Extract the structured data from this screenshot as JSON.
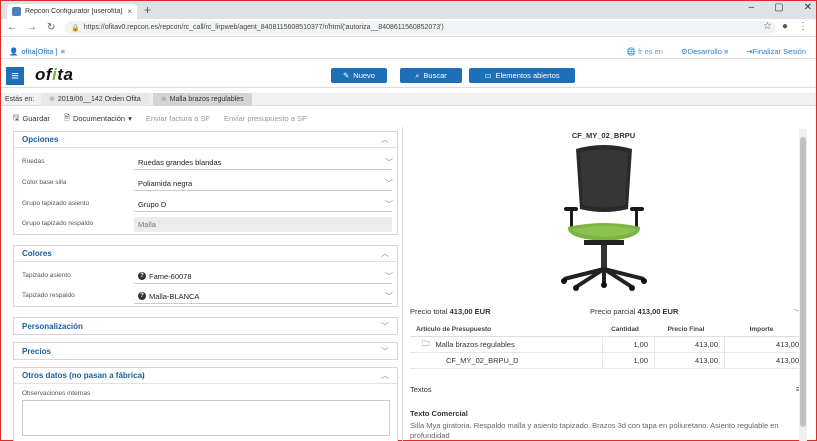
{
  "browser": {
    "tab_title": "Repcon Configurator [userofita]",
    "tab_close": "×",
    "new_tab": "+",
    "url": "https://ofitav0.repcon.es/repcon/rc_call/rc_lirpweb/agent_8408115608510377/r/html('autoriza__8408611560852073')",
    "win_min": "–",
    "win_max": "▢",
    "win_close": "✕"
  },
  "top": {
    "user": "ofita[Ofita ]",
    "languages": "fr  es  en",
    "env": "Desarrollo",
    "logout": "Finalizar Sesión"
  },
  "appbar": {
    "logo_a": "of",
    "logo_b": "i",
    "logo_c": "ta",
    "nuevo": "Nuevo",
    "buscar": "Buscar",
    "abiertos": "Elementos abiertos"
  },
  "breadcrumb": {
    "label": "Estás en:",
    "items": [
      "2019/06__142 Orden Ofita",
      "Malla brazos regulables"
    ]
  },
  "toolbar": {
    "guardar": "Guardar",
    "documentacion": "Documentación",
    "enviar_factura": "Enviar factura a SF",
    "enviar_presupuesto": "Enviar presupuesto a SF"
  },
  "opciones": {
    "title": "Opciones",
    "rows": [
      {
        "label": "Ruedas",
        "value": "Ruedas grandes blandas"
      },
      {
        "label": "Color base silla",
        "value": "Poliamida negra"
      },
      {
        "label": "Grupo tapizado asiento",
        "value": "Grupo D"
      },
      {
        "label": "Grupo tapizado respaldo",
        "value": "Malla"
      }
    ]
  },
  "colores": {
    "title": "Colores",
    "rows": [
      {
        "label": "Tapizado asiento",
        "value": "Fame-60078"
      },
      {
        "label": "Tapizado respaldo",
        "value": "Malla-BLANCA"
      }
    ]
  },
  "personalizacion": {
    "title": "Personalización"
  },
  "precios": {
    "title": "Precios"
  },
  "otros": {
    "title": "Otros datos (no pasan a fábrica)",
    "obs_label": "Observaciones internas"
  },
  "product": {
    "ref": "CF_MY_02_BRPU",
    "precio_total_label": "Precio total",
    "precio_total": "413,00 EUR",
    "precio_parcial_label": "Precio parcial",
    "precio_parcial": "413,00 EUR"
  },
  "table": {
    "headers": [
      "Artículo de Presupuesto",
      "Cantidad",
      "Precio Final",
      "Importe"
    ],
    "rows": [
      {
        "articulo": "Malla brazos regulables",
        "cantidad": "1,00",
        "precio": "413,00",
        "importe": "413,00"
      },
      {
        "articulo": "CF_MY_02_BRPU_D",
        "cantidad": "1,00",
        "precio": "413,00",
        "importe": "413,00"
      }
    ]
  },
  "textos": {
    "title": "Textos",
    "sub": "Texto Comercial",
    "body": "Silla Mya giratoria. Respaldo malla y asiento tapizado. Brazos 3d con tapa en poliuretano. Asiento regulable en profundidad"
  },
  "colors": {
    "accent": "#1d6fb8",
    "seat_green": "#7cb342"
  }
}
